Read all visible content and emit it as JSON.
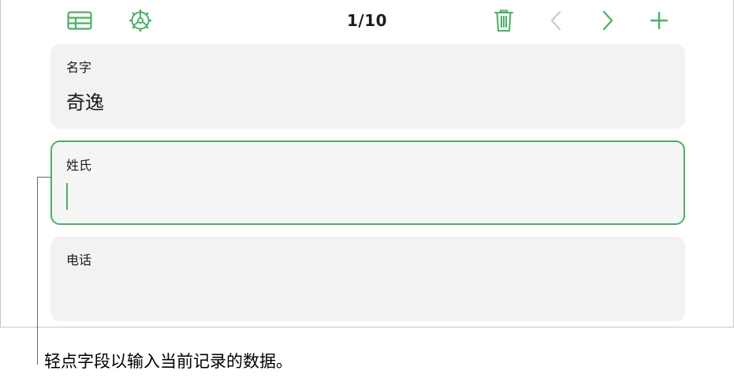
{
  "toolbar": {
    "counter": "1/10",
    "icons": {
      "table": "table-view-icon",
      "settings": "gear-icon",
      "delete": "trash-icon",
      "previous": "chevron-left-icon",
      "next": "chevron-right-icon",
      "add": "plus-icon"
    }
  },
  "fields": [
    {
      "label": "名字",
      "value": "奇逸"
    },
    {
      "label": "姓氏",
      "value": ""
    },
    {
      "label": "电话",
      "value": ""
    }
  ],
  "caption": "轻点字段以输入当前记录的数据。",
  "colors": {
    "accent": "#4caf63",
    "disabled": "#c8c8cc",
    "field_bg": "#f2f2f4"
  }
}
